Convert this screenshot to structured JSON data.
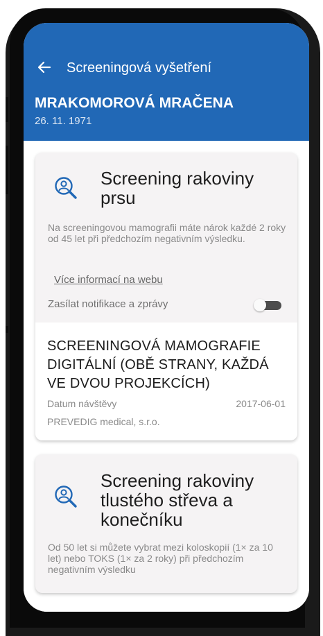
{
  "header": {
    "title": "Screeningová vyšetření",
    "patient_name": "MRAKOMOROVÁ MRAČENA",
    "patient_dob": "26. 11. 1971"
  },
  "cards": [
    {
      "title_line1": "Screening rakoviny",
      "title_line2": "prsu",
      "description": "Na screeningovou mamografii máte nárok každé 2 roky od 45 let při předchozím negativním výsledku.",
      "link": "Více informací na webu",
      "notification_label": "Zasílat notifikace a zprávy",
      "notification_enabled": false,
      "exam": {
        "title": "SCREENINGOVÁ MAMOGRAFIE DIGITÁLNÍ (OBĚ STRANY, KAŽDÁ VE DVOU PROJEKCÍCH)",
        "visit_label": "Datum návštěvy",
        "visit_date": "2017-06-01",
        "provider": "PREVEDIG medical, s.r.o."
      }
    },
    {
      "title_line1": "Screening rakoviny",
      "title_line2": "tlustého střeva a",
      "title_line3": "konečníku",
      "description": "Od 50 let si můžete vybrat mezi koloskopií (1× za 10 let) nebo TOKS (1× za 2 roky) při předchozím negativním výsledku"
    }
  ],
  "colors": {
    "appbar": "#2168b6",
    "card_bg": "#f5f3f4",
    "accent_icon": "#2168b6"
  },
  "icons": {
    "back": "arrow-left-icon",
    "search": "search-person-icon"
  }
}
